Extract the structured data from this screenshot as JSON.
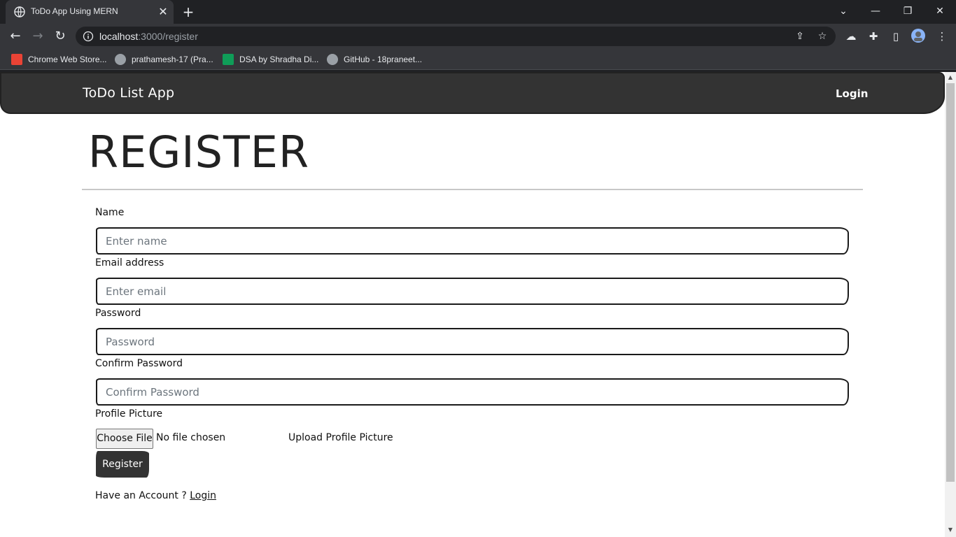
{
  "browser": {
    "tab_title": "ToDo App Using MERN",
    "tab_icon": "globe-icon",
    "url_host": "localhost",
    "url_path": ":3000/register",
    "bookmarks": [
      {
        "label": "Chrome Web Store...",
        "icon": "chrome-web-store-icon"
      },
      {
        "label": "prathamesh-17 (Pra...",
        "icon": "github-icon"
      },
      {
        "label": "DSA by Shradha Di...",
        "icon": "sheets-icon"
      },
      {
        "label": "GitHub - 18praneet...",
        "icon": "github-icon"
      }
    ]
  },
  "navbar": {
    "brand": "ToDo List App",
    "login": "Login"
  },
  "page": {
    "heading": "REGISTER"
  },
  "form": {
    "name_label": "Name",
    "name_placeholder": "Enter name",
    "email_label": "Email address",
    "email_placeholder": "Enter email",
    "password_label": "Password",
    "password_placeholder": "Password",
    "confirm_label": "Confirm Password",
    "confirm_placeholder": "Confirm Password",
    "picture_label": "Profile Picture",
    "choose_file": "Choose File",
    "file_status": "No file chosen",
    "upload_label": "Upload Profile Picture",
    "register_button": "Register",
    "have_account": "Have an Account ?",
    "login_link": "Login"
  },
  "colors": {
    "navbar_bg": "#333333",
    "button_bg": "#333333",
    "text": "#111111"
  }
}
